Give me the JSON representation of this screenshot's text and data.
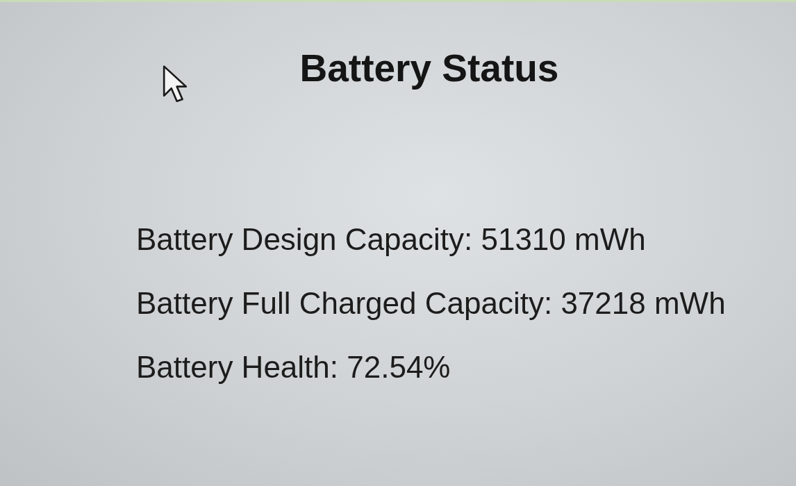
{
  "title": "Battery Status",
  "lines": [
    "Battery Design Capacity: 51310 mWh",
    "Battery Full Charged Capacity: 37218 mWh",
    "Battery Health: 72.54%"
  ]
}
